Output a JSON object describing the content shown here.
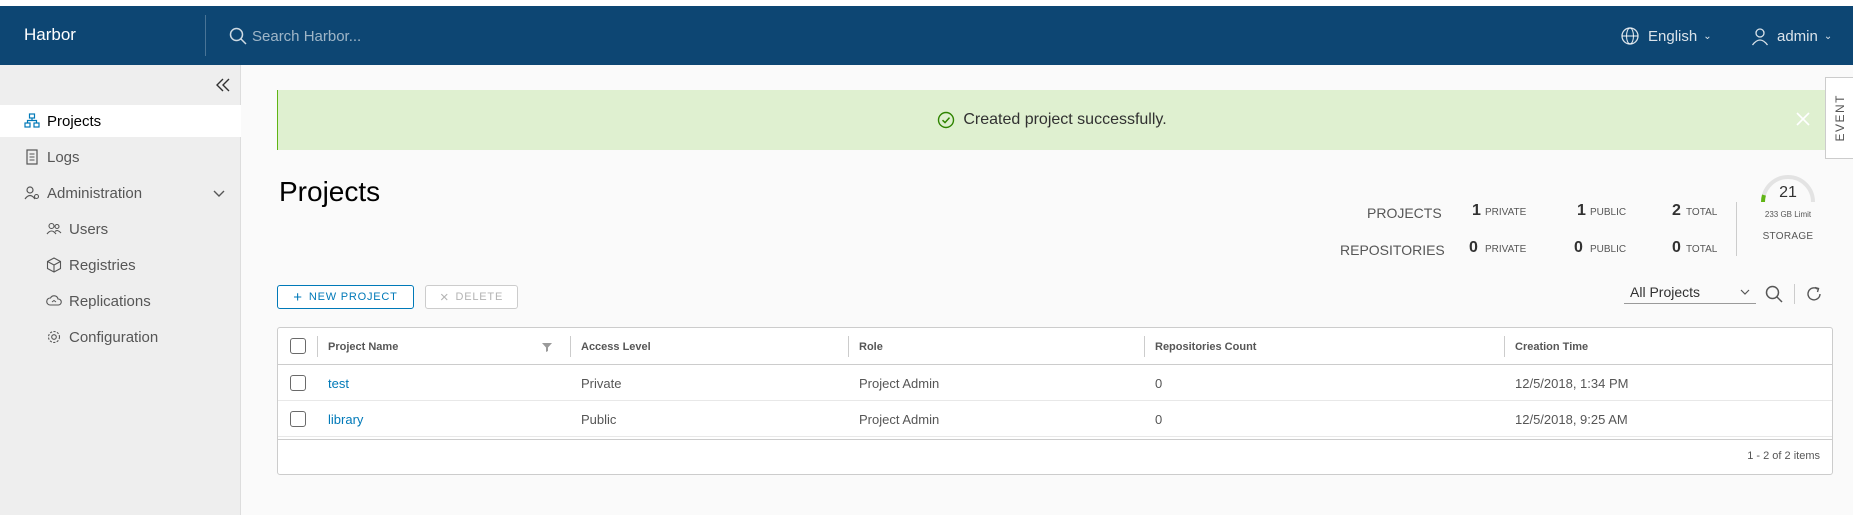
{
  "header": {
    "brand": "Harbor",
    "search_placeholder": "Search Harbor...",
    "language": "English",
    "user": "admin"
  },
  "sidebar": {
    "items": [
      {
        "label": "Projects",
        "icon": "projects-icon"
      },
      {
        "label": "Logs",
        "icon": "logs-icon"
      },
      {
        "label": "Administration",
        "icon": "administration-icon"
      },
      {
        "label": "Users",
        "icon": "users-icon"
      },
      {
        "label": "Registries",
        "icon": "registries-icon"
      },
      {
        "label": "Replications",
        "icon": "replications-icon"
      },
      {
        "label": "Configuration",
        "icon": "configuration-icon"
      }
    ]
  },
  "alert": {
    "message": "Created project successfully."
  },
  "event_tab": "EVENT",
  "page": {
    "title": "Projects"
  },
  "stats": {
    "projects_label": "PROJECTS",
    "repositories_label": "REPOSITORIES",
    "projects": {
      "private": "1",
      "public": "1",
      "total": "2"
    },
    "repositories": {
      "private": "0",
      "public": "0",
      "total": "0"
    },
    "private_label": "PRIVATE",
    "public_label": "PUBLIC",
    "total_label": "TOTAL",
    "storage": {
      "value": "21",
      "limit": "233 GB Limit",
      "label": "STORAGE",
      "used_fraction": 0.09
    }
  },
  "toolbar": {
    "new_project": "NEW PROJECT",
    "delete": "DELETE",
    "filter_value": "All Projects"
  },
  "table": {
    "columns": [
      "Project Name",
      "Access Level",
      "Role",
      "Repositories Count",
      "Creation Time"
    ],
    "rows": [
      {
        "name": "test",
        "access": "Private",
        "role": "Project Admin",
        "repos": "0",
        "created": "12/5/2018, 1:34 PM"
      },
      {
        "name": "library",
        "access": "Public",
        "role": "Project Admin",
        "repos": "0",
        "created": "12/5/2018, 9:25 AM"
      }
    ],
    "footer": "1 - 2 of 2 items"
  },
  "colors": {
    "header_bg": "#0d4673",
    "accent": "#0079b8",
    "success_bg": "#dff0d0",
    "success_icon": "#2f8400",
    "gauge": "#60b515"
  }
}
